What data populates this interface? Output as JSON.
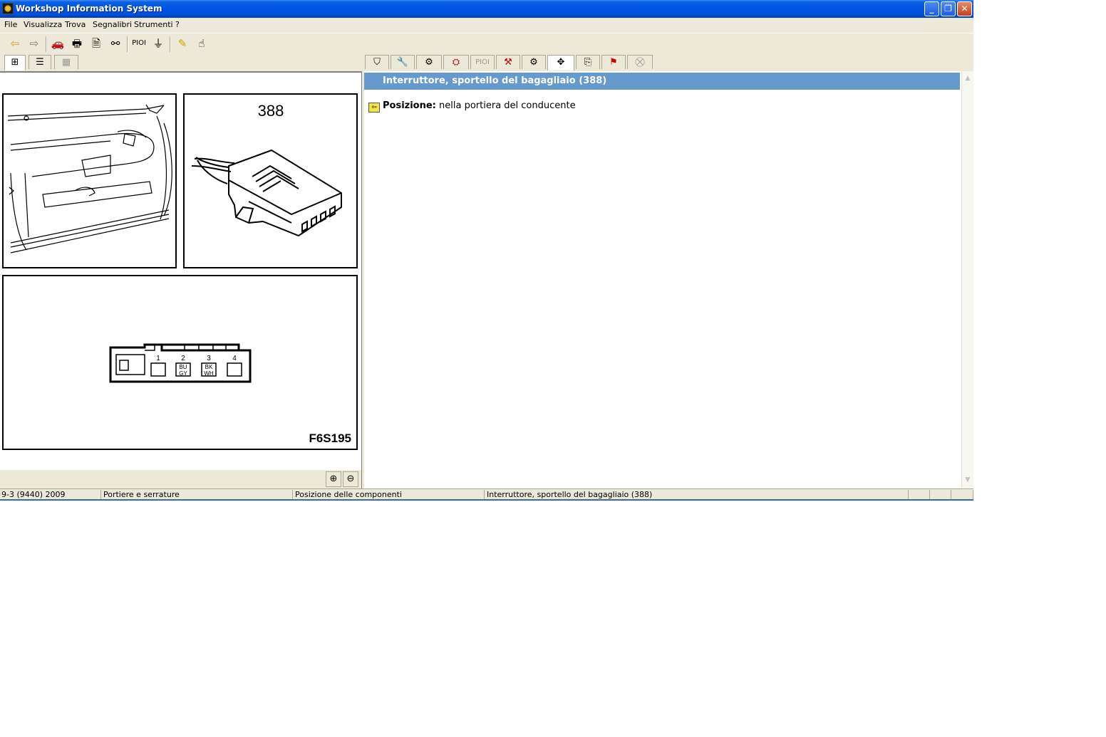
{
  "window": {
    "title": "Workshop Information System"
  },
  "menu": [
    "File",
    "Visualizza",
    "Trova",
    "Segnalibri",
    "Strumenti",
    "?"
  ],
  "toolbar": {
    "pioi_label": "PIOI"
  },
  "tabs": {
    "pioi_label": "PIOI"
  },
  "illustration": {
    "component_number": "388",
    "image_code": "F6S195",
    "pins": [
      "1",
      "2",
      "3",
      "4"
    ],
    "wire_colors": {
      "pin2": [
        "BU",
        "GY"
      ],
      "pin3": [
        "BK",
        "WH"
      ]
    }
  },
  "content": {
    "heading": "Interruttore, sportello del bagagliaio (388)",
    "position_label": "Posizione:",
    "position_value": "nella portiera del conducente"
  },
  "status": [
    "9-3 (9440) 2009",
    "Portiere e serrature",
    "Posizione delle componenti",
    "Interruttore, sportello del bagagliaio (388)"
  ],
  "colors": {
    "heading_bg": "#6699cc",
    "titlebar": "#0054e3"
  }
}
